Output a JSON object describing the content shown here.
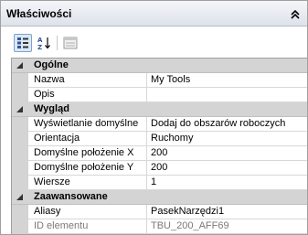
{
  "panel": {
    "title": "Właściwości",
    "collapse_icon": "double-chevron-up-icon"
  },
  "toolbar": {
    "buttons": [
      {
        "name": "categorized-view-icon",
        "active": true
      },
      {
        "name": "alphabetical-sort-icon",
        "active": false
      },
      {
        "name": "property-pages-icon",
        "active": false
      }
    ]
  },
  "grid": {
    "categories": [
      {
        "label": "Ogólne",
        "expanded": true,
        "properties": [
          {
            "name": "Nazwa",
            "value": "My Tools",
            "readonly": false
          },
          {
            "name": "Opis",
            "value": "",
            "readonly": false
          }
        ]
      },
      {
        "label": "Wygląd",
        "expanded": true,
        "properties": [
          {
            "name": "Wyświetlanie domyślne",
            "value": "Dodaj do obszarów roboczych",
            "readonly": false
          },
          {
            "name": "Orientacja",
            "value": "Ruchomy",
            "readonly": false
          },
          {
            "name": "Domyślne położenie X",
            "value": "200",
            "readonly": false
          },
          {
            "name": "Domyślne położenie Y",
            "value": "200",
            "readonly": false
          },
          {
            "name": "Wiersze",
            "value": "1",
            "readonly": false
          }
        ]
      },
      {
        "label": "Zaawansowane",
        "expanded": true,
        "properties": [
          {
            "name": "Aliasy",
            "value": "PasekNarzędzi1",
            "readonly": false
          },
          {
            "name": "ID elementu",
            "value": "TBU_200_AFF69",
            "readonly": true
          }
        ]
      }
    ]
  }
}
